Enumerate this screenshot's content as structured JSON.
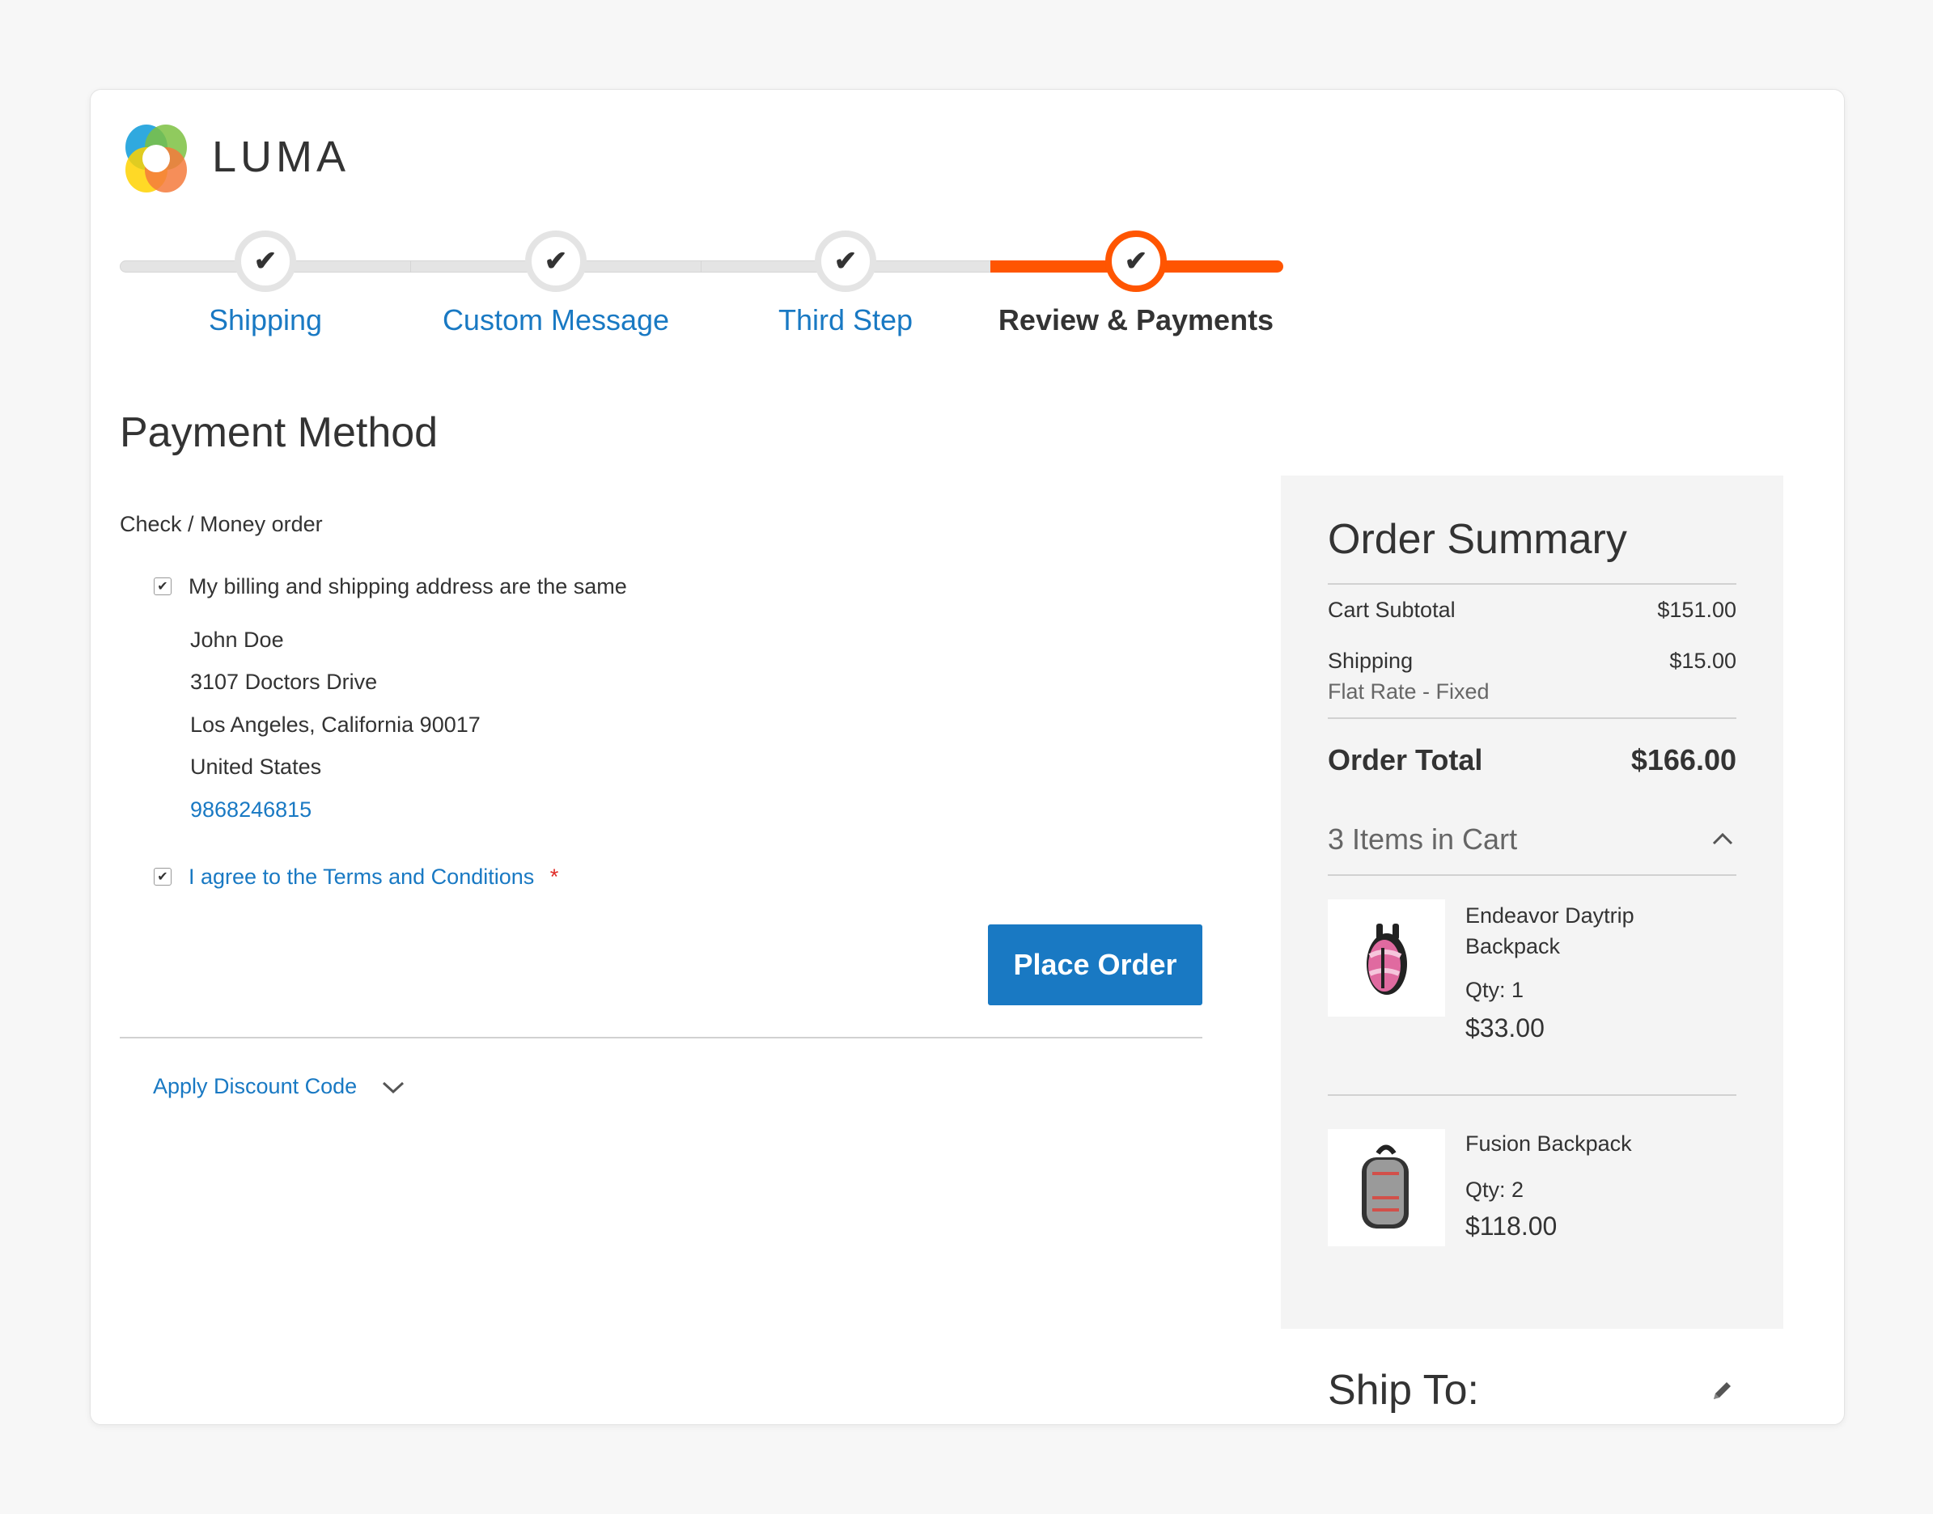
{
  "brand": {
    "name": "LUMA"
  },
  "colors": {
    "accent": "#ff5501",
    "link": "#1979c3",
    "button": "#1979c3"
  },
  "progress": {
    "steps": [
      {
        "label": "Shipping",
        "state": "complete"
      },
      {
        "label": "Custom Message",
        "state": "complete"
      },
      {
        "label": "Third Step",
        "state": "complete"
      },
      {
        "label": "Review & Payments",
        "state": "active"
      }
    ]
  },
  "payment": {
    "title": "Payment Method",
    "method": "Check / Money order",
    "same_address_label": "My billing and shipping address are the same",
    "same_address_checked": true,
    "address": {
      "name": "John Doe",
      "street": "3107 Doctors Drive",
      "city_line": "Los Angeles, California 90017",
      "country": "United States",
      "phone": "9868246815"
    },
    "terms_label": "I agree to the Terms and Conditions",
    "terms_required_mark": "*",
    "terms_checked": true,
    "place_order": "Place Order",
    "discount_label": "Apply Discount Code"
  },
  "summary": {
    "title": "Order Summary",
    "subtotal_label": "Cart Subtotal",
    "subtotal_value": "$151.00",
    "shipping_label": "Shipping",
    "shipping_method": "Flat Rate - Fixed",
    "shipping_value": "$15.00",
    "total_label": "Order Total",
    "total_value": "$166.00",
    "items_in_cart": "3 Items in Cart",
    "items": [
      {
        "name_line1": "Endeavor Daytrip",
        "name_line2": "Backpack",
        "qty": "Qty: 1",
        "price": "$33.00"
      },
      {
        "name_line1": "Fusion Backpack",
        "qty": "Qty: 2",
        "price": "$118.00"
      }
    ]
  },
  "ship_to": {
    "title": "Ship To:"
  }
}
